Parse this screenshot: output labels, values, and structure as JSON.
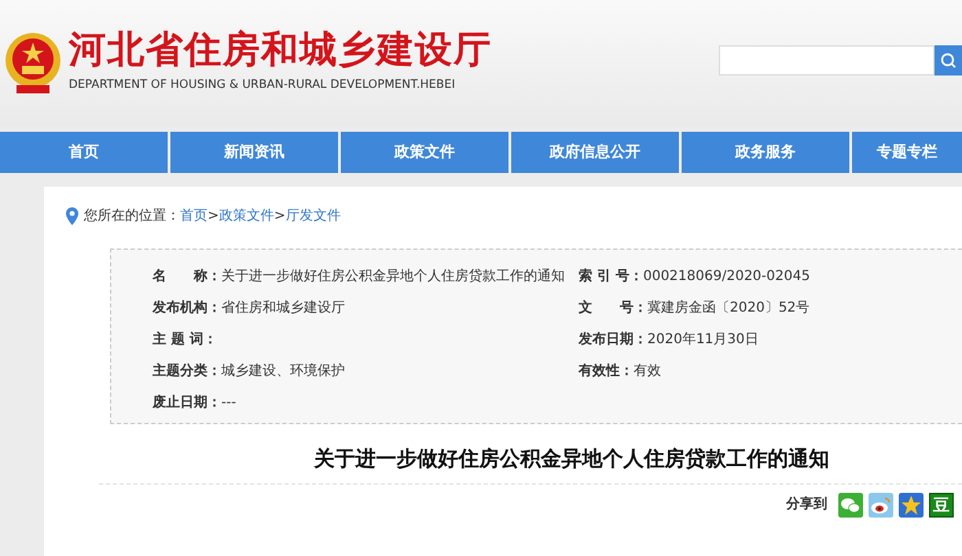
{
  "header": {
    "title": "河北省住房和城乡建设厅",
    "subtitle": "DEPARTMENT OF HOUSING & URBAN-RURAL DEVELOPMENT.HEBEI"
  },
  "nav": [
    {
      "label": "首页"
    },
    {
      "label": "新闻资讯"
    },
    {
      "label": "政策文件"
    },
    {
      "label": "政府信息公开"
    },
    {
      "label": "政务服务"
    },
    {
      "label": "专题专栏"
    }
  ],
  "breadcrumb": {
    "prefix": "您所在的位置：",
    "links": [
      "首页",
      "政策文件",
      "厅发文件"
    ],
    "separator": ">"
  },
  "meta_left": [
    {
      "field": "名　　称：",
      "content": "关于进一步做好住房公积金异地个人住房贷款工作的通知"
    },
    {
      "field": "发布机构：",
      "content": "省住房和城乡建设厅"
    },
    {
      "field": "主 题 词："
    },
    {
      "field": "主题分类：",
      "content": "城乡建设、环境保护"
    },
    {
      "field": "废止日期：",
      "content": "---"
    }
  ],
  "meta_right": [
    {
      "field": "索 引 号：",
      "content": "000218069/2020-02045"
    },
    {
      "field": "文　　号：",
      "content": "冀建房金函〔2020〕52号"
    },
    {
      "field": "发布日期：",
      "content": "2020年11月30日"
    },
    {
      "field": "有效性：",
      "content": "有效"
    }
  ],
  "article_title": "关于进一步做好住房公积金异地个人住房贷款工作的通知",
  "share": {
    "label": "分享到",
    "icons": [
      {
        "kind": "wechat"
      },
      {
        "kind": "weibo"
      },
      {
        "kind": "star"
      },
      {
        "kind": "douban",
        "text": "豆"
      }
    ]
  }
}
